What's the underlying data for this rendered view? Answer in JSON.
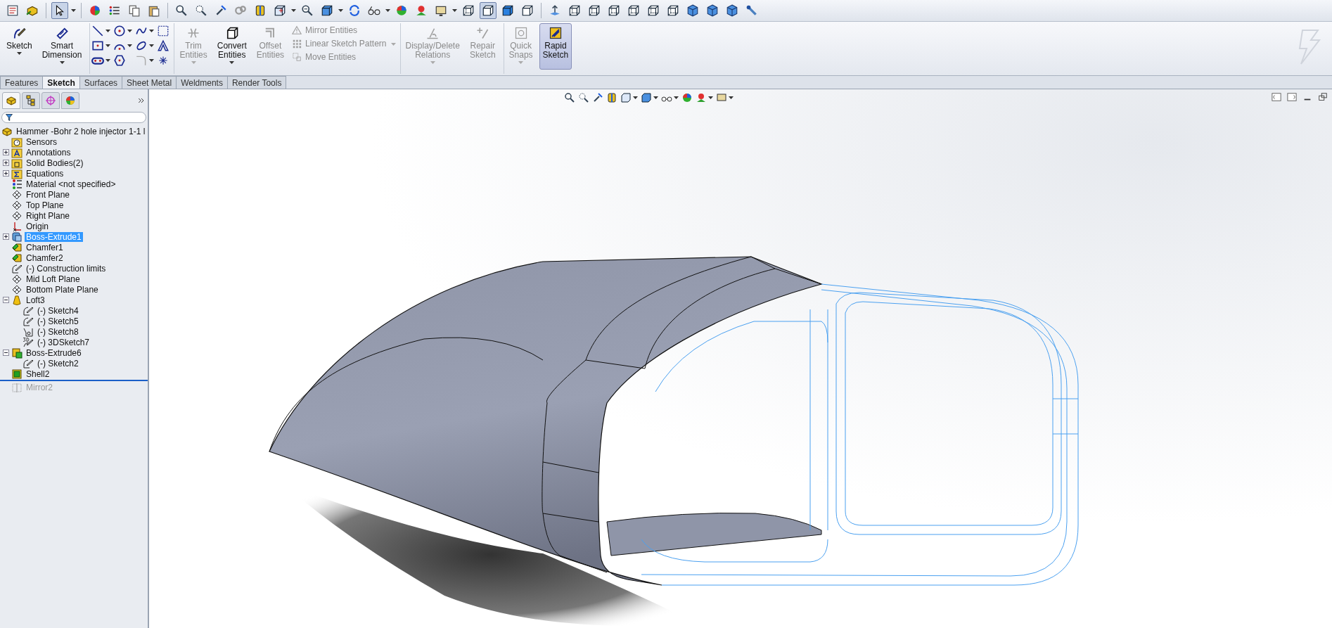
{
  "top_toolbar": {
    "select_tool": {
      "selected": true
    },
    "display_styles": [
      {
        "selected": false
      },
      {
        "selected": true
      },
      {
        "selected": false
      },
      {
        "selected": false
      }
    ]
  },
  "command_manager": {
    "large_tools": [
      {
        "label": "Sketch",
        "kind": "sketch",
        "disabled": false
      },
      {
        "label": "Smart Dimension",
        "kind": "dimension",
        "disabled": false
      }
    ],
    "entity_tools": [
      {
        "label": "Trim Entities",
        "kind": "trim",
        "disabled": true
      },
      {
        "label": "Convert Entities",
        "kind": "convert",
        "disabled": false
      },
      {
        "label": "Offset Entities",
        "kind": "offset",
        "disabled": true
      }
    ],
    "entity_list": [
      {
        "label": "Mirror Entities",
        "kind": "mirror",
        "disabled": true
      },
      {
        "label": "Linear Sketch Pattern",
        "kind": "pattern",
        "disabled": true
      },
      {
        "label": "Move Entities",
        "kind": "move",
        "disabled": true
      }
    ],
    "relation_tools": [
      {
        "label": "Display/Delete Relations",
        "kind": "relations",
        "disabled": true
      },
      {
        "label": "Repair Sketch",
        "kind": "repair",
        "disabled": true
      },
      {
        "label": "Quick Snaps",
        "kind": "snaps",
        "disabled": true
      },
      {
        "label": "Rapid Sketch",
        "kind": "rapid",
        "disabled": false,
        "on": true
      }
    ]
  },
  "tabs": [
    {
      "label": "Features",
      "selected": false
    },
    {
      "label": "Sketch",
      "selected": true
    },
    {
      "label": "Surfaces",
      "selected": false
    },
    {
      "label": "Sheet Metal",
      "selected": false
    },
    {
      "label": "Weldments",
      "selected": false
    },
    {
      "label": "Render Tools",
      "selected": false
    }
  ],
  "panel_tabs": [
    {
      "selected": true
    },
    {
      "selected": false
    },
    {
      "selected": false
    },
    {
      "selected": false
    }
  ],
  "feature_tree": {
    "label": "Hammer -Bohr 2 hole injector 1-1 l",
    "kind": "part",
    "children": [
      {
        "label": "Sensors",
        "kind": "sensor-folder",
        "selected": false
      },
      {
        "label": "Annotations",
        "kind": "annotation-folder",
        "expanded": false,
        "selected": false
      },
      {
        "label": "Solid Bodies(2)",
        "kind": "body-folder",
        "expanded": false,
        "selected": false
      },
      {
        "label": "Equations",
        "kind": "equation-folder",
        "expanded": false,
        "selected": false
      },
      {
        "label": "Material <not specified>",
        "kind": "material",
        "selected": false
      },
      {
        "label": "Front Plane",
        "kind": "plane",
        "selected": false
      },
      {
        "label": "Top Plane",
        "kind": "plane",
        "selected": false
      },
      {
        "label": "Right Plane",
        "kind": "plane",
        "selected": false
      },
      {
        "label": "Origin",
        "kind": "origin",
        "selected": false
      },
      {
        "label": "Boss-Extrude1",
        "kind": "extrude",
        "expanded": false,
        "selected": true
      },
      {
        "label": "Chamfer1",
        "kind": "chamfer",
        "selected": false
      },
      {
        "label": "Chamfer2",
        "kind": "chamfer",
        "selected": false
      },
      {
        "label": "(-) Construction limits",
        "kind": "sketch",
        "selected": false
      },
      {
        "label": "Mid Loft Plane",
        "kind": "plane",
        "selected": false
      },
      {
        "label": "Bottom Plate Plane",
        "kind": "plane",
        "selected": false
      },
      {
        "label": "Loft3",
        "kind": "loft",
        "expanded": true,
        "selected": false,
        "children": [
          {
            "label": "(-) Sketch4",
            "kind": "sketch",
            "selected": false
          },
          {
            "label": "(-) Sketch5",
            "kind": "sketch",
            "selected": false
          },
          {
            "label": "(-) Sketch8",
            "kind": "sketch-circle",
            "selected": false
          },
          {
            "label": "(-) 3DSketch7",
            "kind": "sketch3d",
            "selected": false
          }
        ]
      },
      {
        "label": "Boss-Extrude6",
        "kind": "extrude2",
        "expanded": true,
        "selected": false,
        "children": [
          {
            "label": "(-) Sketch2",
            "kind": "sketch",
            "selected": false
          }
        ]
      },
      {
        "label": "Shell2",
        "kind": "shell",
        "selected": false
      },
      {
        "label": "Mirror2",
        "kind": "mirror",
        "selected": false,
        "rolled_back": true
      }
    ]
  }
}
